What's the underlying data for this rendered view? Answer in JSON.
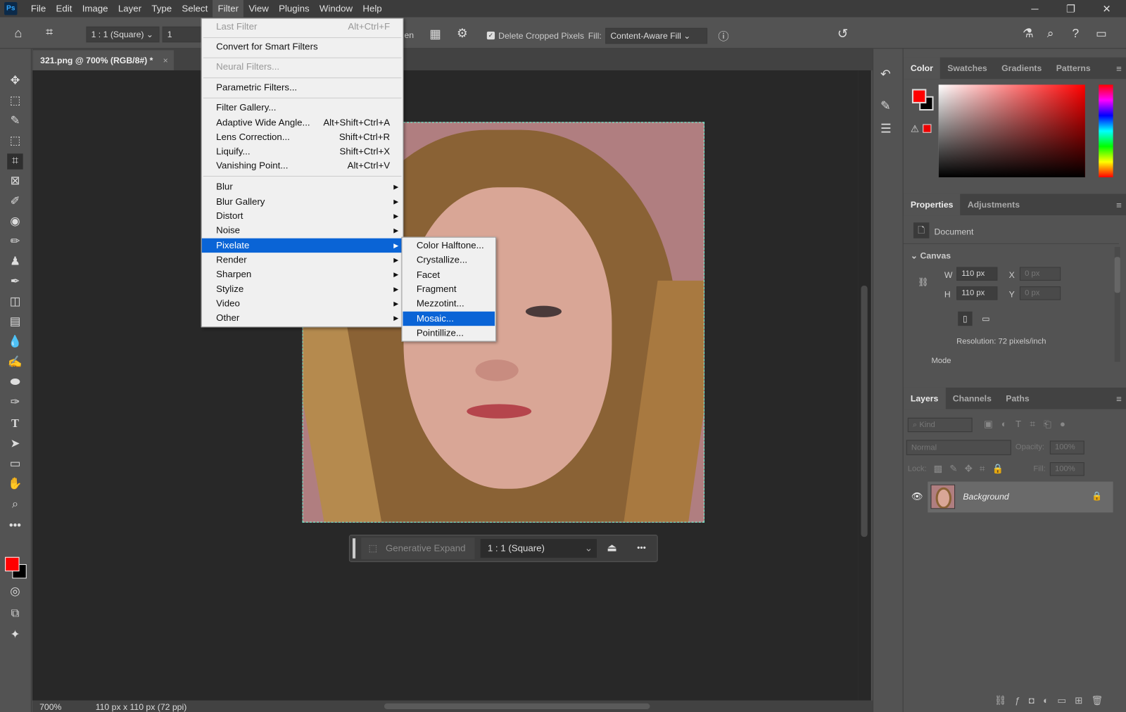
{
  "app": {
    "logo": "Ps"
  },
  "menubar": {
    "items": [
      "File",
      "Edit",
      "Image",
      "Layer",
      "Type",
      "Select",
      "Filter",
      "View",
      "Plugins",
      "Window",
      "Help"
    ],
    "active": "Filter"
  },
  "window_controls": {
    "minimize": "─",
    "restore": "❐",
    "close": "✕"
  },
  "options": {
    "ratio": "1 : 1 (Square)",
    "value": "1",
    "clear_partial": "en",
    "delete_cropped": "Delete Cropped Pixels",
    "delete_cropped_checked": true,
    "fill_label": "Fill:",
    "fill_value": "Content-Aware Fill"
  },
  "document": {
    "tab_title": "321.png @ 700% (RGB/8#) *",
    "zoom": "700%",
    "info": "110 px x 110 px (72 ppi)"
  },
  "filter_menu": {
    "last_filter": {
      "label": "Last Filter",
      "shortcut": "Alt+Ctrl+F"
    },
    "convert": "Convert for Smart Filters",
    "neural": "Neural Filters...",
    "parametric": "Parametric Filters...",
    "items_a": [
      {
        "label": "Filter Gallery...",
        "shortcut": ""
      },
      {
        "label": "Adaptive Wide Angle...",
        "shortcut": "Alt+Shift+Ctrl+A"
      },
      {
        "label": "Lens Correction...",
        "shortcut": "Shift+Ctrl+R"
      },
      {
        "label": "Liquify...",
        "shortcut": "Shift+Ctrl+X"
      },
      {
        "label": "Vanishing Point...",
        "shortcut": "Alt+Ctrl+V"
      }
    ],
    "submenus": [
      "Blur",
      "Blur Gallery",
      "Distort",
      "Noise",
      "Pixelate",
      "Render",
      "Sharpen",
      "Stylize",
      "Video",
      "Other"
    ],
    "selected": "Pixelate"
  },
  "pixelate_submenu": {
    "items": [
      "Color Halftone...",
      "Crystallize...",
      "Facet",
      "Fragment",
      "Mezzotint...",
      "Mosaic...",
      "Pointillize..."
    ],
    "selected": "Mosaic..."
  },
  "context_bar": {
    "generative_expand": "Generative Expand",
    "ratio": "1 : 1 (Square)",
    "more": "•••"
  },
  "color_panel": {
    "tabs": [
      "Color",
      "Swatches",
      "Gradients",
      "Patterns"
    ],
    "foreground": "#ff0000",
    "background": "#000000"
  },
  "properties_panel": {
    "tabs": [
      "Properties",
      "Adjustments"
    ],
    "doc_label": "Document",
    "section": "Canvas",
    "w_label": "W",
    "w_value": "110 px",
    "h_label": "H",
    "h_value": "110 px",
    "x_label": "X",
    "x_value": "0 px",
    "y_label": "Y",
    "y_value": "0 px",
    "resolution": "Resolution: 72 pixels/inch",
    "mode": "Mode"
  },
  "layers_panel": {
    "tabs": [
      "Layers",
      "Channels",
      "Paths"
    ],
    "kind_placeholder": "Kind",
    "blend_mode": "Normal",
    "opacity_label": "Opacity:",
    "opacity": "100%",
    "lock_label": "Lock:",
    "fill_label": "Fill:",
    "fill": "100%",
    "layers": [
      {
        "name": "Background",
        "visible": true,
        "locked": true
      }
    ]
  },
  "colors": {
    "accent": "#0a64d6",
    "foreground": "#ff0000"
  }
}
